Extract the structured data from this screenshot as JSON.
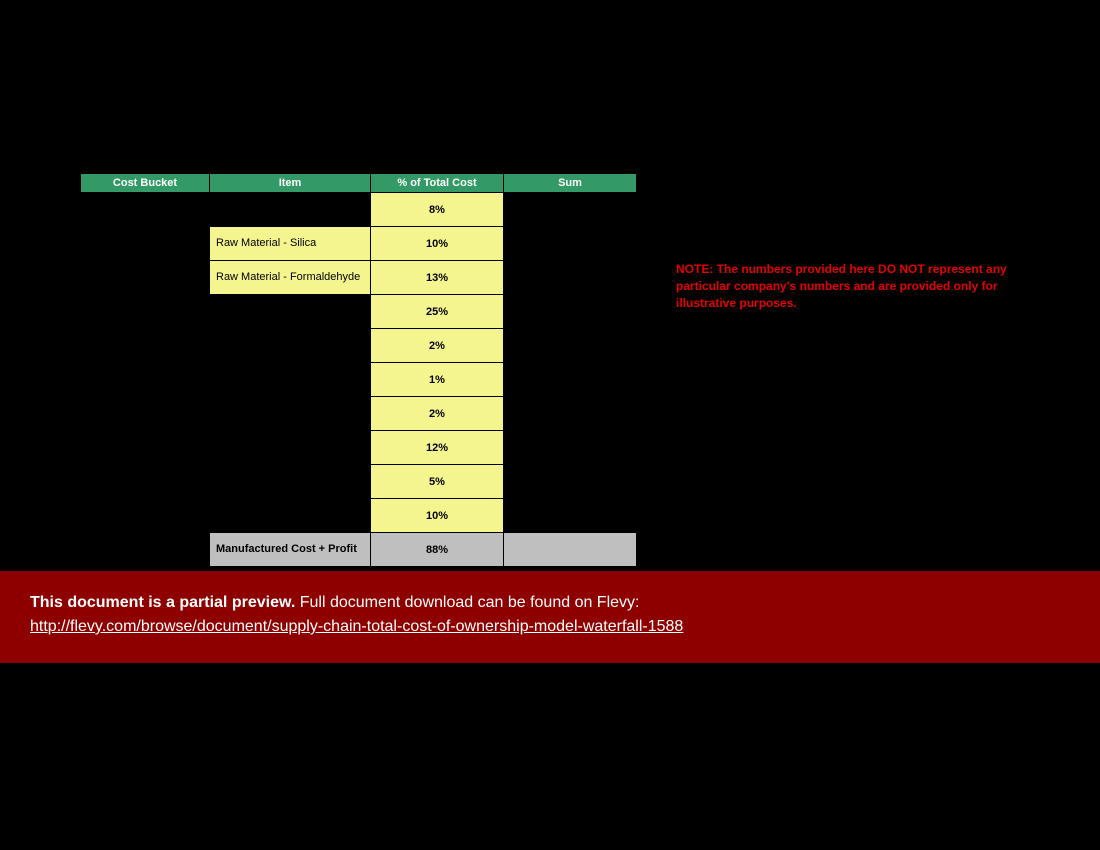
{
  "table": {
    "headers": [
      "Cost Bucket",
      "Item",
      "% of Total Cost",
      "Sum"
    ],
    "rows": [
      {
        "item": "",
        "pct": "8%"
      },
      {
        "item": "Raw Material - Silica",
        "pct": "10%"
      },
      {
        "item": "Raw Material - Formaldehyde",
        "pct": "13%"
      },
      {
        "item": "",
        "pct": "25%"
      },
      {
        "item": "",
        "pct": "2%"
      },
      {
        "item": "",
        "pct": "1%"
      },
      {
        "item": "",
        "pct": "2%"
      },
      {
        "item": "",
        "pct": "12%"
      },
      {
        "item": "",
        "pct": "5%"
      },
      {
        "item": "",
        "pct": "10%"
      }
    ],
    "subtotal": {
      "item": "Manufactured Cost + Profit",
      "pct": "88%"
    }
  },
  "note": "NOTE: The numbers provided here DO NOT represent any particular company's numbers and are provided only for illustrative purposes.",
  "banner": {
    "lead": "This document is a partial preview.",
    "rest": "  Full document download can be found on Flevy:",
    "url_text": "http://flevy.com/browse/document/supply-chain-total-cost-of-ownership-model-waterfall-1588",
    "url_href": "http://flevy.com/browse/document/supply-chain-total-cost-of-ownership-model-waterfall-1588"
  }
}
